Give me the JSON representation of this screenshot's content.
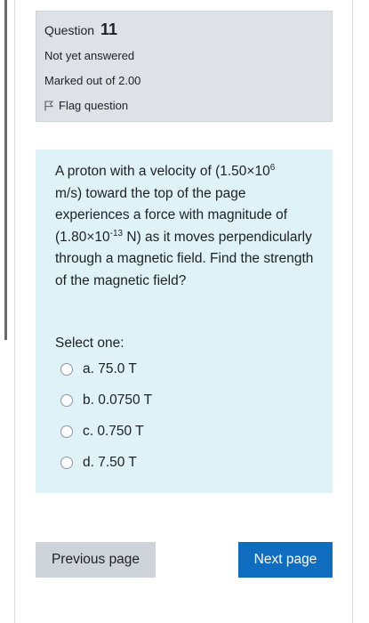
{
  "question_info": {
    "label": "Question",
    "number": "11",
    "state": "Not yet answered",
    "grade": "Marked out of 2.00",
    "flag_label": "Flag question"
  },
  "question": {
    "text_part1": "A proton with a velocity of (1.50×10",
    "exp1": "6",
    "text_part2": "m/s) toward the top of the page experiences a force with magnitude of (1.80×10",
    "exp2": "-13",
    "text_part3": " N) as it moves perpendicularly through a magnetic field. Find the strength of the magnetic field?",
    "select_label": "Select one:",
    "options": [
      {
        "label": "a. 75.0 T"
      },
      {
        "label": "b. 0.0750 T"
      },
      {
        "label": "c. 0.750 T"
      },
      {
        "label": "d. 7.50 T"
      }
    ]
  },
  "navigation": {
    "previous_label": "Previous page",
    "next_label": "Next page"
  },
  "colors": {
    "info_background": "#dee2e6",
    "question_background": "#def2f8",
    "next_button": "#0f6cbf",
    "previous_button": "#ced4da"
  },
  "icons": {
    "flag": "flag-icon"
  }
}
